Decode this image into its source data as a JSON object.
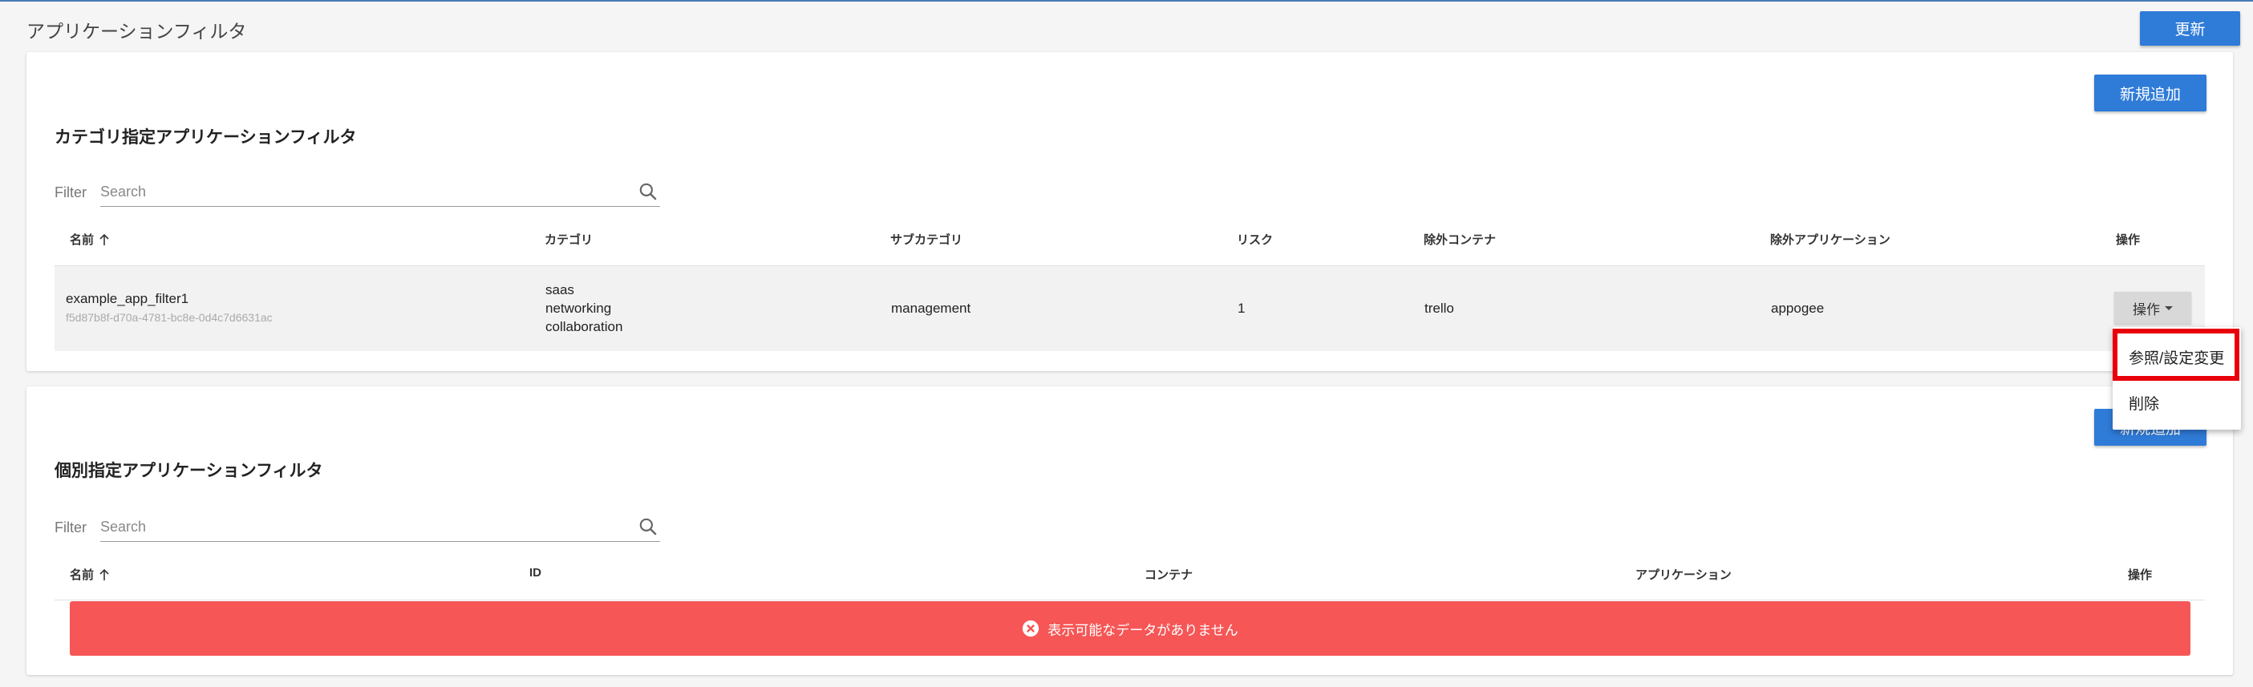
{
  "page": {
    "title": "アプリケーションフィルタ",
    "refresh_label": "更新"
  },
  "category_section": {
    "title": "カテゴリ指定アプリケーションフィルタ",
    "add_label": "新規追加",
    "filter_label": "Filter",
    "search_placeholder": "Search",
    "columns": [
      "名前",
      "カテゴリ",
      "サブカテゴリ",
      "リスク",
      "除外コンテナ",
      "除外アプリケーション",
      "操作"
    ],
    "rows": [
      {
        "name": "example_app_filter1",
        "id": "f5d87b8f-d70a-4781-bc8e-0d4c7d6631ac",
        "categories": [
          "saas",
          "networking",
          "collaboration"
        ],
        "subcategory": "management",
        "risk": "1",
        "excluded_container": "trello",
        "excluded_application": "appogee",
        "ops_label": "操作"
      }
    ]
  },
  "individual_section": {
    "title": "個別指定アプリケーションフィルタ",
    "add_label": "新規追加",
    "filter_label": "Filter",
    "search_placeholder": "Search",
    "columns": [
      "名前",
      "ID",
      "コンテナ",
      "アプリケーション",
      "操作"
    ],
    "empty_message": "表示可能なデータがありません"
  },
  "dropdown": {
    "items": [
      "参照/設定変更",
      "削除"
    ]
  },
  "colors": {
    "accent": "#2f7bd8",
    "error": "#f65656",
    "highlight": "#e8000a"
  }
}
